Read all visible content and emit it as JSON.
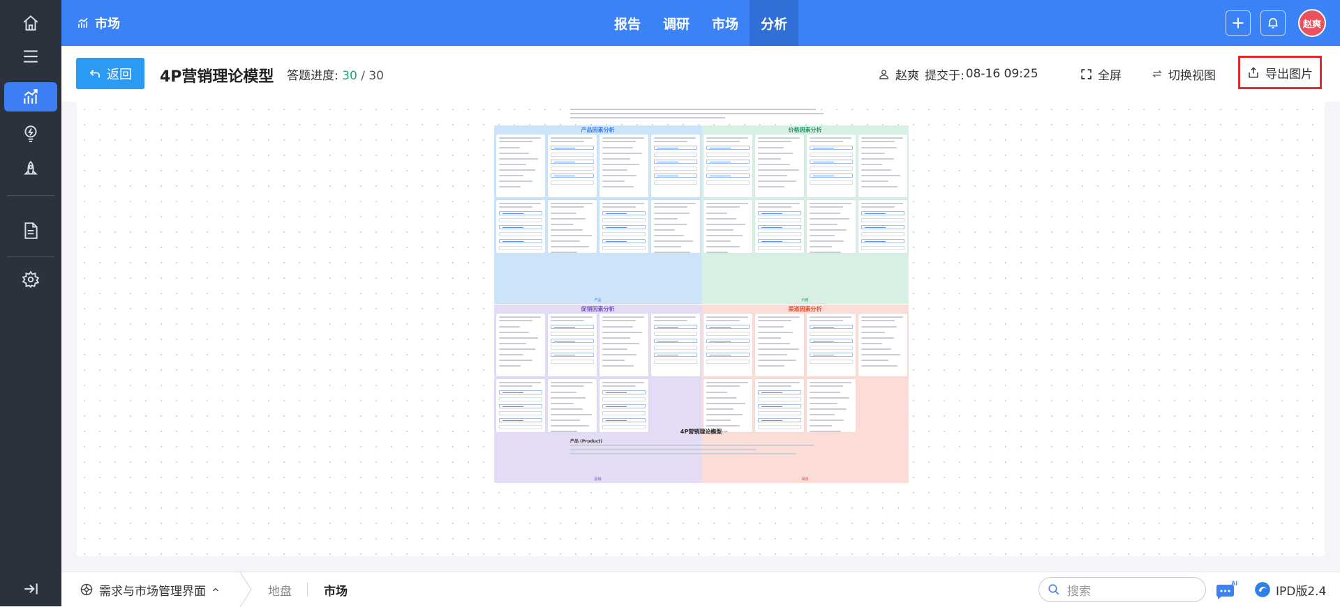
{
  "header": {
    "module_title": "市场",
    "tabs": [
      {
        "label": "报告",
        "active": false
      },
      {
        "label": "调研",
        "active": false
      },
      {
        "label": "市场",
        "active": false
      },
      {
        "label": "分析",
        "active": true
      }
    ],
    "user_avatar": "赵爽"
  },
  "sidebar": {
    "items": [
      {
        "icon": "home-icon"
      },
      {
        "icon": "menu-icon"
      },
      {
        "icon": "chart-icon",
        "active": true
      },
      {
        "icon": "lightbulb-icon"
      },
      {
        "icon": "rocket-icon"
      },
      {
        "icon": "document-icon"
      },
      {
        "icon": "gear-icon"
      }
    ],
    "collapse_icon": "collapse-icon"
  },
  "toolbar": {
    "back_label": "返回",
    "title": "4P营销理论模型",
    "progress_label": "答题进度:",
    "progress_done": "30",
    "progress_sep": "/",
    "progress_total": "30",
    "user_name": "赵爽",
    "submitted_label": "提交于:",
    "submitted_time": "08-16 09:25",
    "fullscreen_label": "全屏",
    "switch_view_label": "切换视图",
    "export_label": "导出图片"
  },
  "document": {
    "quadrants": [
      {
        "title": "产品因素分析",
        "footer": "产品",
        "color": "#3b82f6"
      },
      {
        "title": "价格因素分析",
        "footer": "价格",
        "color": "#22a06b"
      },
      {
        "title": "促销因素分析",
        "footer": "促销",
        "color": "#7b56c6"
      },
      {
        "title": "渠道因素分析",
        "footer": "渠道",
        "color": "#e0563c"
      }
    ],
    "bottom_title": "4P营销理论模型",
    "section_heading": "产品 (Product)"
  },
  "bottombar": {
    "workspace_label": "需求与市场管理界面",
    "breadcrumb": [
      "地盘",
      "市场"
    ],
    "search_placeholder": "搜索",
    "ai_badge": "AI",
    "version": "IPD版2.4"
  }
}
